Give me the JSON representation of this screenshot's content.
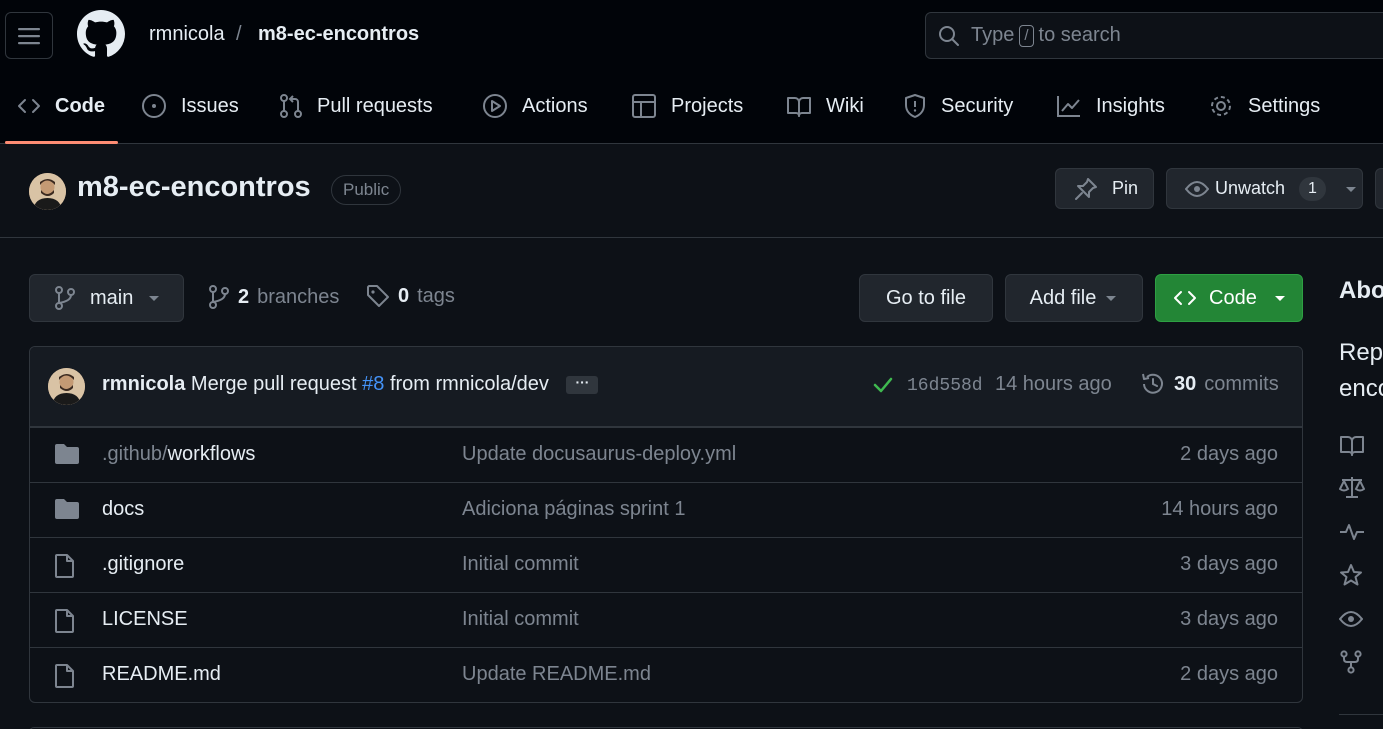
{
  "header": {
    "owner": "rmnicola",
    "separator": "/",
    "repo": "m8-ec-encontros",
    "search": {
      "prefix": "Type",
      "key": "/",
      "suffix": "to search"
    }
  },
  "nav": {
    "tabs": [
      {
        "label": "Code",
        "icon": "code-icon"
      },
      {
        "label": "Issues",
        "icon": "issue-icon"
      },
      {
        "label": "Pull requests",
        "icon": "pull-request-icon"
      },
      {
        "label": "Actions",
        "icon": "play-icon"
      },
      {
        "label": "Projects",
        "icon": "table-icon"
      },
      {
        "label": "Wiki",
        "icon": "book-icon"
      },
      {
        "label": "Security",
        "icon": "shield-icon"
      },
      {
        "label": "Insights",
        "icon": "graph-icon"
      },
      {
        "label": "Settings",
        "icon": "gear-icon"
      }
    ]
  },
  "repo_header": {
    "name": "m8-ec-encontros",
    "visibility": "Public",
    "pin_label": "Pin",
    "watch_label": "Unwatch",
    "watch_count": "1"
  },
  "toolbar": {
    "branch": "main",
    "branches_count": "2",
    "branches_label": "branches",
    "tags_count": "0",
    "tags_label": "tags",
    "go_to_file": "Go to file",
    "add_file": "Add file",
    "code": "Code"
  },
  "latest_commit": {
    "author": "rmnicola",
    "message_prefix": "Merge pull request",
    "pr_link": "#8",
    "message_suffix": "from rmnicola/dev",
    "ellipsis": "···",
    "sha": "16d558d",
    "time": "14 hours ago",
    "commits_count": "30",
    "commits_label": "commits"
  },
  "files": [
    {
      "type": "folder",
      "dim_prefix": ".github/",
      "name": "workflows",
      "message": "Update docusaurus-deploy.yml",
      "age": "2 days ago"
    },
    {
      "type": "folder",
      "dim_prefix": "",
      "name": "docs",
      "message": "Adiciona páginas sprint 1",
      "age": "14 hours ago"
    },
    {
      "type": "file",
      "dim_prefix": "",
      "name": ".gitignore",
      "message": "Initial commit",
      "age": "3 days ago"
    },
    {
      "type": "file",
      "dim_prefix": "",
      "name": "LICENSE",
      "message": "Initial commit",
      "age": "3 days ago"
    },
    {
      "type": "file",
      "dim_prefix": "",
      "name": "README.md",
      "message": "Update README.md",
      "age": "2 days ago"
    }
  ],
  "sidebar": {
    "about_title": "Abo",
    "description_line1": "Rep",
    "description_line2": "enco",
    "icons": [
      "book-icon",
      "law-icon",
      "pulse-icon",
      "star-icon",
      "eye-icon",
      "fork-icon"
    ]
  },
  "colors": {
    "background": "#0d1117",
    "header": "#010409",
    "accent_underline": "#fd8c73",
    "code_button": "#238636",
    "link": "#4493f8",
    "success": "#3fb950"
  }
}
